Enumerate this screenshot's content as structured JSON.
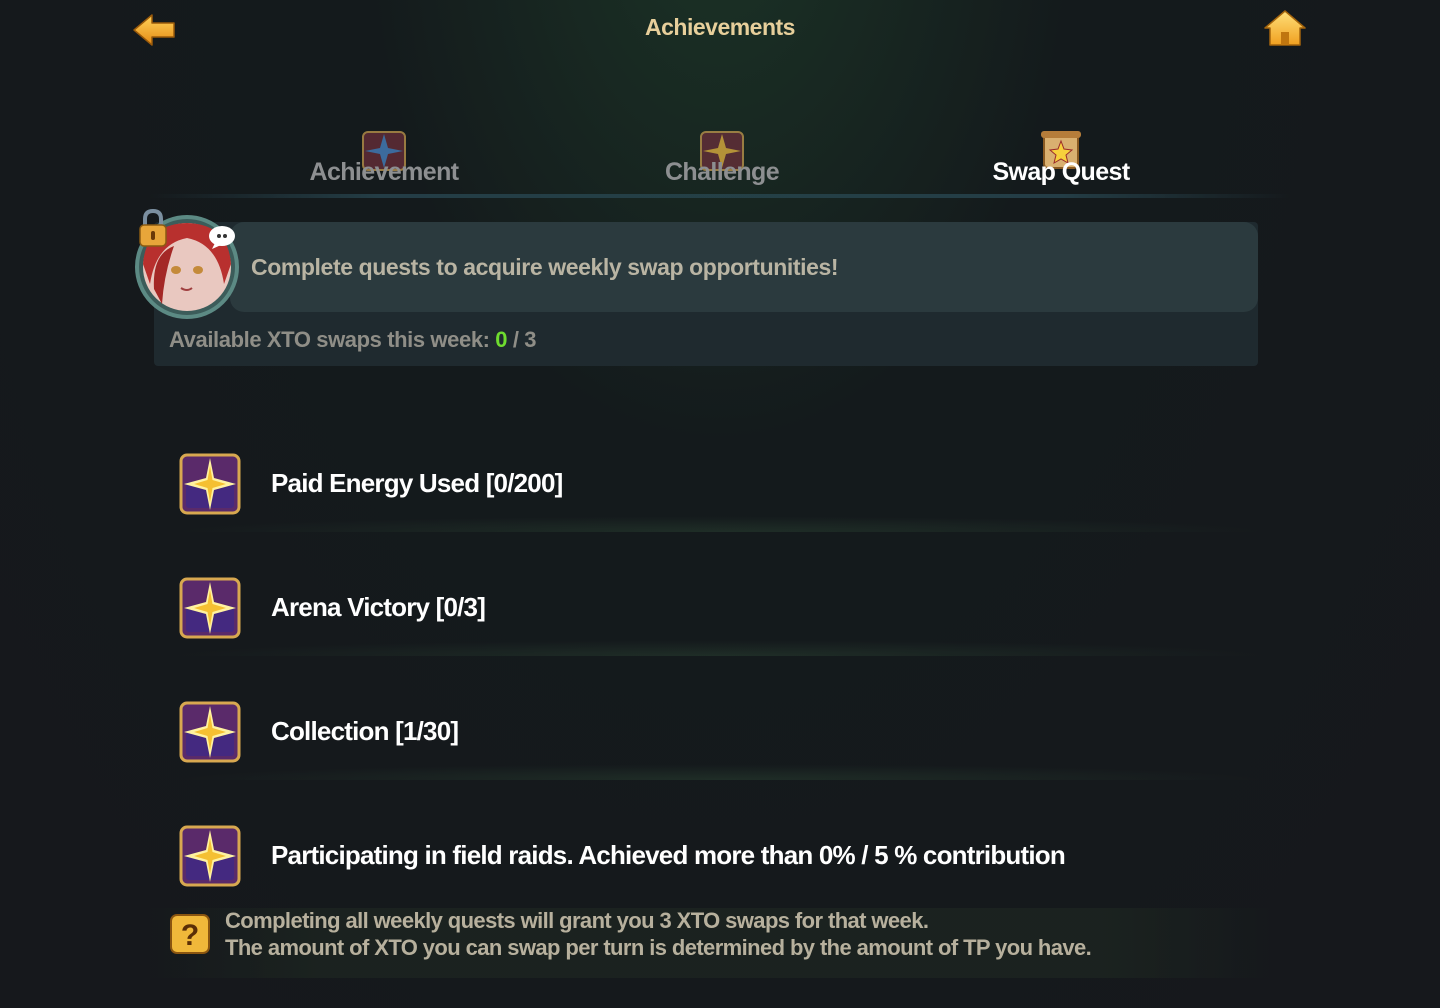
{
  "header": {
    "title": "Achievements",
    "back_icon": "back-arrow-icon",
    "home_icon": "home-icon"
  },
  "tabs": [
    {
      "label": "Achievement",
      "icon": "compass-star-emblem-icon",
      "active": false
    },
    {
      "label": "Challenge",
      "icon": "star-emblem-icon",
      "active": false
    },
    {
      "label": "Swap Quest",
      "icon": "scroll-star-icon",
      "active": true
    }
  ],
  "info": {
    "message": "Complete quests to acquire weekly swap opportunities!",
    "swaps_label": "Available XTO swaps this week: ",
    "swaps_used": "0",
    "swaps_sep": " / ",
    "swaps_total": "3"
  },
  "quests": [
    {
      "label": "Paid Energy Used [0/200]",
      "icon": "star-badge-icon"
    },
    {
      "label": "Arena Victory [0/3]",
      "icon": "star-badge-icon"
    },
    {
      "label": "Collection [1/30]",
      "icon": "star-badge-icon"
    },
    {
      "label": "Participating in field raids. Achieved more than 0% / 5 % contribution",
      "icon": "star-badge-icon"
    }
  ],
  "footer": {
    "line1": "Completing all weekly quests will grant you 3 XTO swaps for that week.",
    "line2": "The amount of XTO you can swap per turn is determined by the amount of TP you have."
  },
  "colors": {
    "accent_gold": "#e7cf9b",
    "progress_green": "#6edc2f",
    "background": "#16181c"
  }
}
